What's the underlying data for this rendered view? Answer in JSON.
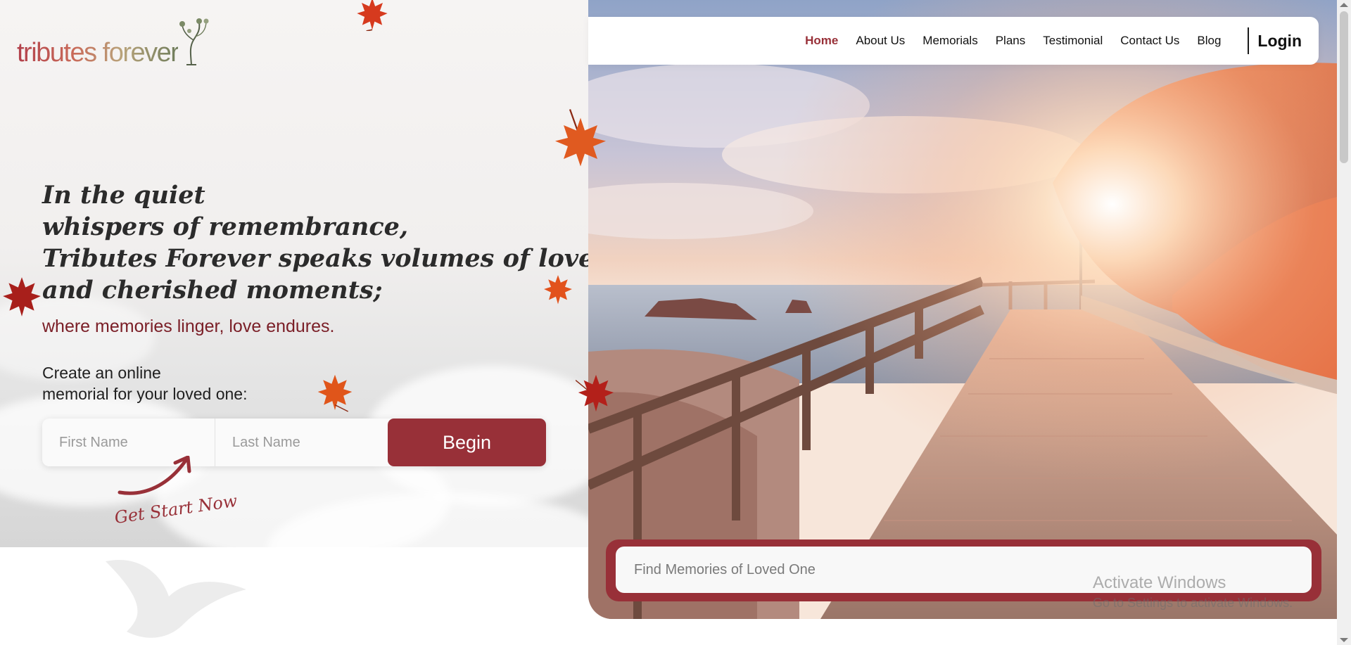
{
  "logo": {
    "text_part1": "tributes",
    "text_part2": " forever",
    "icon": "tree-face-icon"
  },
  "nav": {
    "items": [
      {
        "label": "Home",
        "active": true
      },
      {
        "label": "About Us"
      },
      {
        "label": "Memorials"
      },
      {
        "label": "Plans"
      },
      {
        "label": "Testimonial"
      },
      {
        "label": "Contact Us"
      },
      {
        "label": "Blog"
      }
    ],
    "login_label": "Login"
  },
  "hero": {
    "headline_lines": [
      "In the quiet",
      "whispers of remembrance,",
      "Tributes Forever speaks volumes of love",
      "and cherished moments;"
    ],
    "tagline": "where memories linger, love endures.",
    "create_lines": [
      "Create an online",
      "memorial for your loved one:"
    ]
  },
  "form": {
    "first_name_placeholder": "First Name",
    "last_name_placeholder": "Last Name",
    "begin_label": "Begin",
    "start_note": "Get Start Now"
  },
  "search": {
    "placeholder": "Find Memories of Loved One"
  },
  "watermark": {
    "title": "Activate Windows",
    "subtitle": "Go to Settings to activate Windows."
  },
  "colors": {
    "brand": "#983038",
    "tagline": "#7a1e26",
    "leaf": "#d8471c"
  },
  "icons": [
    "maple-leaf-icon",
    "arrow-icon",
    "dove-icon"
  ]
}
